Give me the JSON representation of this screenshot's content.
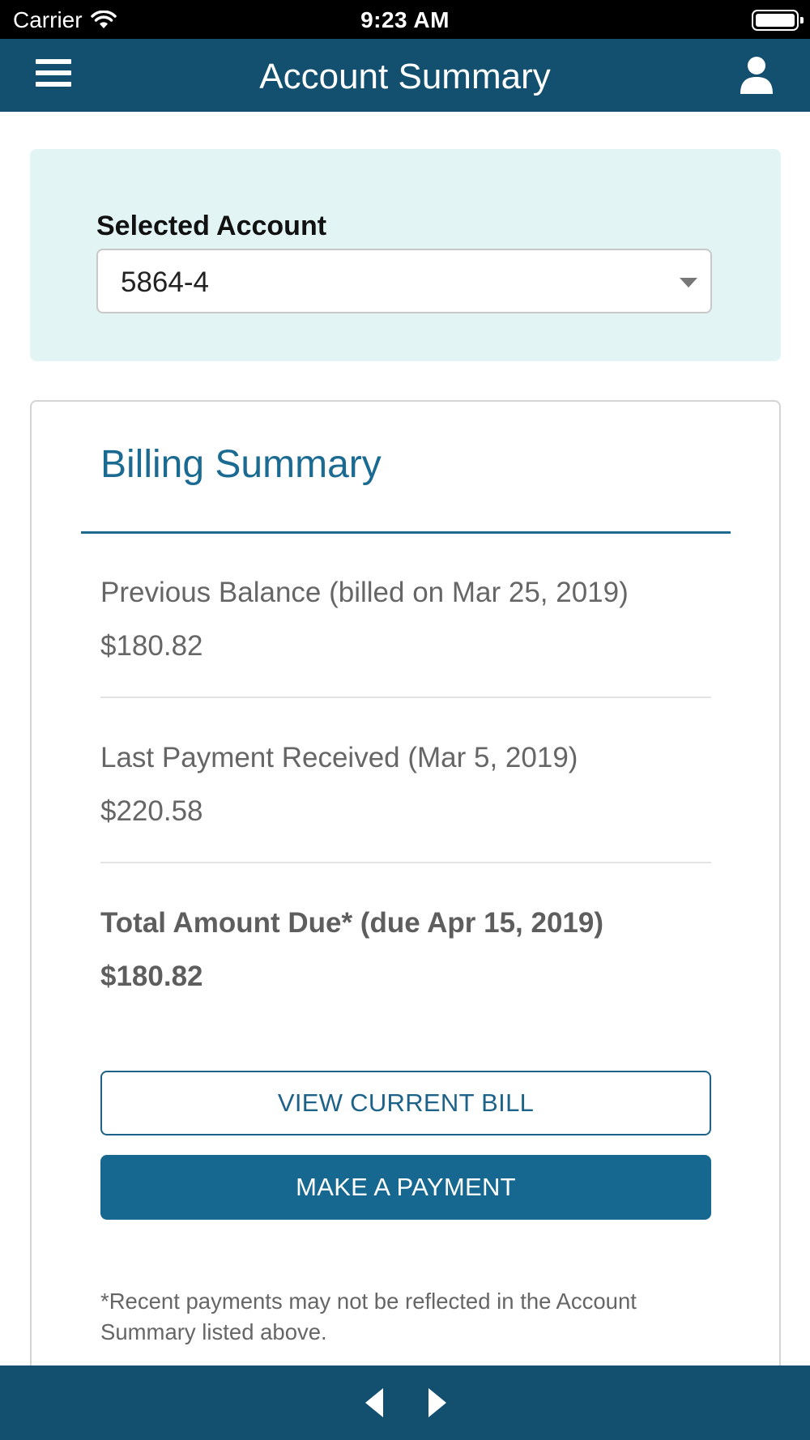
{
  "status_bar": {
    "carrier": "Carrier",
    "time": "9:23 AM"
  },
  "nav_bar": {
    "title": "Account Summary",
    "menu_icon": "hamburger-menu-icon",
    "profile_icon": "user-profile-icon"
  },
  "account": {
    "label": "Selected Account",
    "selected_value": "5864-4"
  },
  "billing": {
    "title": "Billing Summary",
    "rows": [
      {
        "label": "Previous Balance (billed on Mar 25, 2019)",
        "amount": "$180.82"
      },
      {
        "label": "Last Payment Received (Mar 5, 2019)",
        "amount": "$220.58"
      },
      {
        "label": "Total Amount Due* (due Apr 15, 2019)",
        "amount": "$180.82"
      }
    ],
    "view_bill_label": "VIEW CURRENT BILL",
    "make_payment_label": "MAKE A PAYMENT",
    "footnote": "*Recent payments may not be reflected in the Account Summary listed above."
  },
  "toolbar": {
    "back_icon": "back-arrow-icon",
    "forward_icon": "forward-arrow-icon"
  },
  "colors": {
    "header": "#134f6e",
    "accent": "#1a6a92",
    "account_panel": "#e2f5f4",
    "primary_button": "#176890"
  }
}
